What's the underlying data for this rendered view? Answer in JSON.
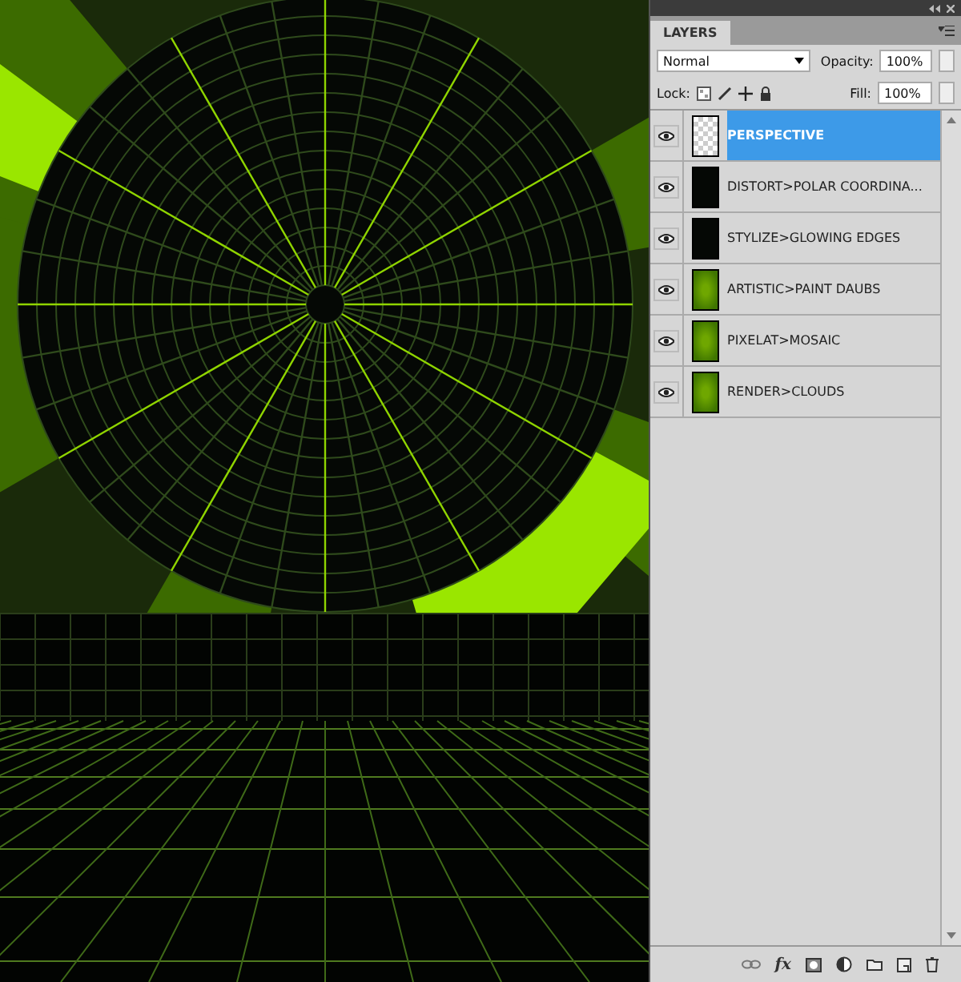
{
  "panel": {
    "tab": "LAYERS",
    "blend_mode": "Normal",
    "opacity_label": "Opacity:",
    "opacity": "100%",
    "lock_label": "Lock:",
    "fill_label": "Fill:",
    "fill": "100%"
  },
  "layers": [
    {
      "name": "PERSPECTIVE",
      "selected": true,
      "visible": true,
      "kind": "transparent"
    },
    {
      "name": "DISTORT>POLAR COORDINA...",
      "selected": false,
      "visible": true,
      "kind": "dark"
    },
    {
      "name": "STYLIZE>GLOWING EDGES",
      "selected": false,
      "visible": true,
      "kind": "dark"
    },
    {
      "name": "ARTISTIC>PAINT DAUBS",
      "selected": false,
      "visible": true,
      "kind": "green"
    },
    {
      "name": "PIXELAT>MOSAIC",
      "selected": false,
      "visible": true,
      "kind": "green"
    },
    {
      "name": "RENDER>CLOUDS",
      "selected": false,
      "visible": true,
      "kind": "green"
    }
  ],
  "footer": [
    {
      "kind": "link"
    },
    {
      "kind": "fx",
      "label": "fx"
    },
    {
      "kind": "mask"
    },
    {
      "kind": "adjust"
    },
    {
      "kind": "folder"
    },
    {
      "kind": "new"
    },
    {
      "kind": "trash"
    }
  ]
}
